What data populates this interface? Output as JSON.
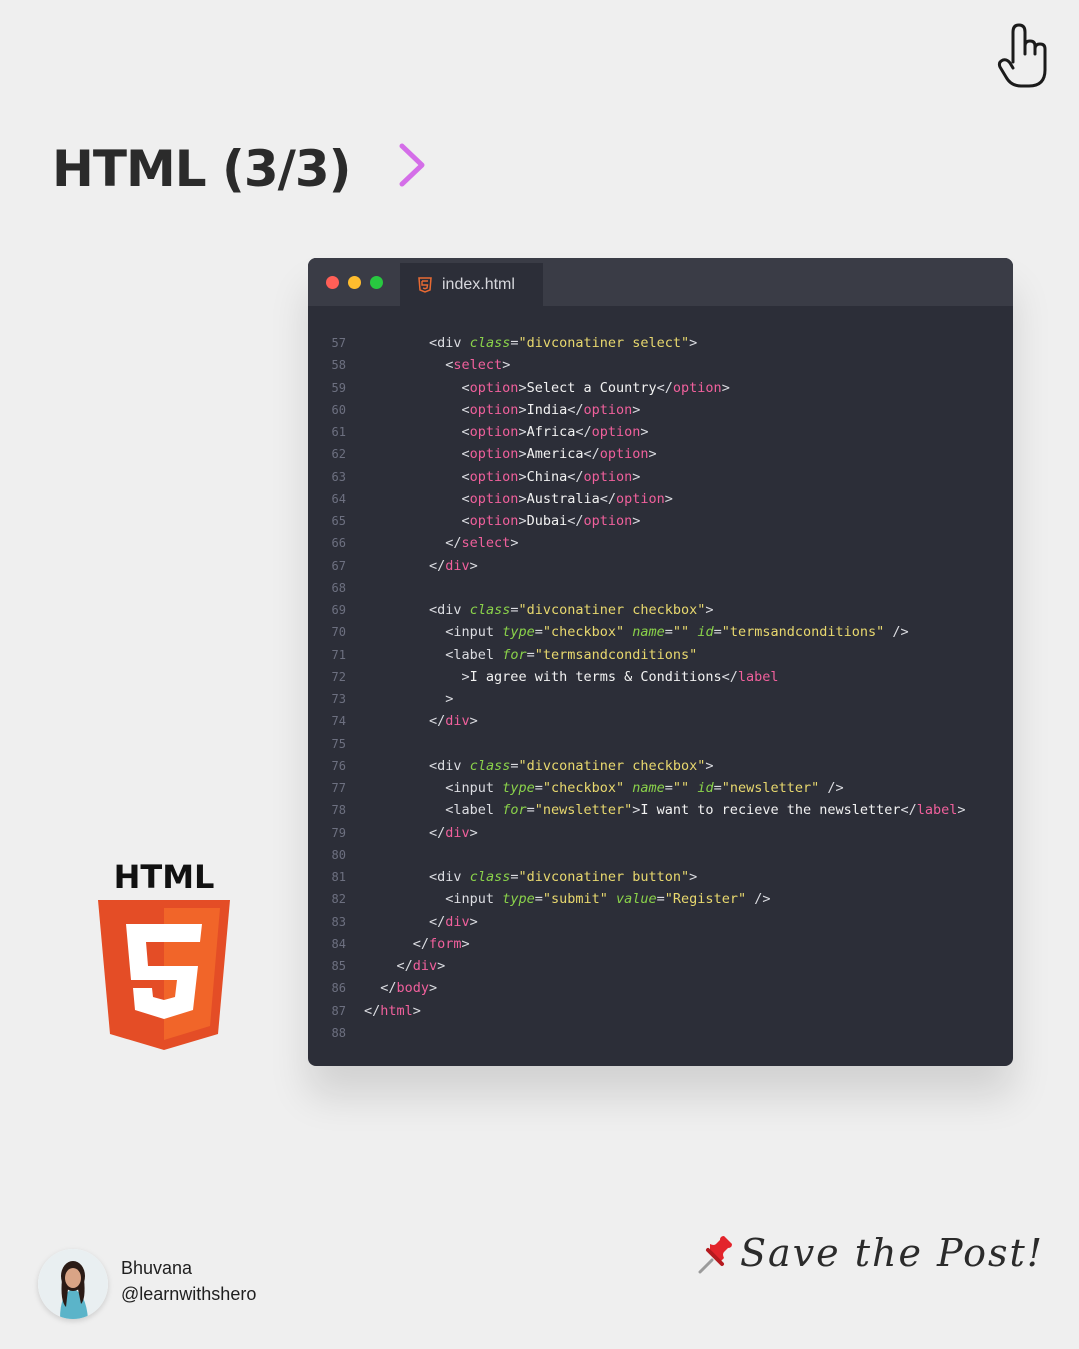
{
  "header": {
    "title": "HTML (3/3)",
    "icons": [
      "arrow-right-icon",
      "pointing-hand-icon"
    ],
    "arrow_gradient": [
      "#7fd0f5",
      "#d46ee8"
    ]
  },
  "editor": {
    "tab_label": "index.html",
    "tab_icon": "html5-icon",
    "window_dots": [
      "#ff5f57",
      "#ffbd2e",
      "#28c840"
    ],
    "colors": {
      "background": "#2c2e38",
      "tag": "#f0609c",
      "attr": "#8ad24a",
      "string": "#e8d86e"
    },
    "lines": [
      {
        "num": "57",
        "tokens": [
          [
            "        <",
            "p"
          ],
          [
            "div",
            "p"
          ],
          [
            " ",
            "p"
          ],
          [
            "class",
            "a"
          ],
          [
            "=",
            "p"
          ],
          [
            "\"divconatiner select\"",
            "s"
          ],
          [
            ">",
            "p"
          ]
        ]
      },
      {
        "num": "58",
        "tokens": [
          [
            "          <",
            "p"
          ],
          [
            "select",
            "t"
          ],
          [
            ">",
            "p"
          ]
        ]
      },
      {
        "num": "59",
        "tokens": [
          [
            "            <",
            "p"
          ],
          [
            "option",
            "t"
          ],
          [
            ">",
            "p"
          ],
          [
            "Select a Country",
            "x"
          ],
          [
            "</",
            "p"
          ],
          [
            "option",
            "t"
          ],
          [
            ">",
            "p"
          ]
        ]
      },
      {
        "num": "60",
        "tokens": [
          [
            "            <",
            "p"
          ],
          [
            "option",
            "t"
          ],
          [
            ">",
            "p"
          ],
          [
            "India",
            "x"
          ],
          [
            "</",
            "p"
          ],
          [
            "option",
            "t"
          ],
          [
            ">",
            "p"
          ]
        ]
      },
      {
        "num": "61",
        "tokens": [
          [
            "            <",
            "p"
          ],
          [
            "option",
            "t"
          ],
          [
            ">",
            "p"
          ],
          [
            "Africa",
            "x"
          ],
          [
            "</",
            "p"
          ],
          [
            "option",
            "t"
          ],
          [
            ">",
            "p"
          ]
        ]
      },
      {
        "num": "62",
        "tokens": [
          [
            "            <",
            "p"
          ],
          [
            "option",
            "t"
          ],
          [
            ">",
            "p"
          ],
          [
            "America",
            "x"
          ],
          [
            "</",
            "p"
          ],
          [
            "option",
            "t"
          ],
          [
            ">",
            "p"
          ]
        ]
      },
      {
        "num": "63",
        "tokens": [
          [
            "            <",
            "p"
          ],
          [
            "option",
            "t"
          ],
          [
            ">",
            "p"
          ],
          [
            "China",
            "x"
          ],
          [
            "</",
            "p"
          ],
          [
            "option",
            "t"
          ],
          [
            ">",
            "p"
          ]
        ]
      },
      {
        "num": "64",
        "tokens": [
          [
            "            <",
            "p"
          ],
          [
            "option",
            "t"
          ],
          [
            ">",
            "p"
          ],
          [
            "Australia",
            "x"
          ],
          [
            "</",
            "p"
          ],
          [
            "option",
            "t"
          ],
          [
            ">",
            "p"
          ]
        ]
      },
      {
        "num": "65",
        "tokens": [
          [
            "            <",
            "p"
          ],
          [
            "option",
            "t"
          ],
          [
            ">",
            "p"
          ],
          [
            "Dubai",
            "x"
          ],
          [
            "</",
            "p"
          ],
          [
            "option",
            "t"
          ],
          [
            ">",
            "p"
          ]
        ]
      },
      {
        "num": "66",
        "tokens": [
          [
            "          </",
            "p"
          ],
          [
            "select",
            "t"
          ],
          [
            ">",
            "p"
          ]
        ]
      },
      {
        "num": "67",
        "tokens": [
          [
            "        </",
            "p"
          ],
          [
            "div",
            "t"
          ],
          [
            ">",
            "p"
          ]
        ]
      },
      {
        "num": "68",
        "tokens": []
      },
      {
        "num": "69",
        "tokens": [
          [
            "        <",
            "p"
          ],
          [
            "div",
            "p"
          ],
          [
            " ",
            "p"
          ],
          [
            "class",
            "a"
          ],
          [
            "=",
            "p"
          ],
          [
            "\"divconatiner checkbox\"",
            "s"
          ],
          [
            ">",
            "p"
          ]
        ]
      },
      {
        "num": "70",
        "tokens": [
          [
            "          <",
            "p"
          ],
          [
            "input",
            "p"
          ],
          [
            " ",
            "p"
          ],
          [
            "type",
            "a"
          ],
          [
            "=",
            "p"
          ],
          [
            "\"checkbox\"",
            "s"
          ],
          [
            " ",
            "p"
          ],
          [
            "name",
            "a"
          ],
          [
            "=",
            "p"
          ],
          [
            "\"\"",
            "s"
          ],
          [
            " ",
            "p"
          ],
          [
            "id",
            "a"
          ],
          [
            "=",
            "p"
          ],
          [
            "\"termsandconditions\"",
            "s"
          ],
          [
            " />",
            "p"
          ]
        ]
      },
      {
        "num": "71",
        "tokens": [
          [
            "          <",
            "p"
          ],
          [
            "label",
            "p"
          ],
          [
            " ",
            "p"
          ],
          [
            "for",
            "a"
          ],
          [
            "=",
            "p"
          ],
          [
            "\"termsandconditions\"",
            "s"
          ]
        ]
      },
      {
        "num": "72",
        "tokens": [
          [
            "            >",
            "p"
          ],
          [
            "I agree with terms & Conditions",
            "x"
          ],
          [
            "</",
            "p"
          ],
          [
            "label",
            "t"
          ]
        ]
      },
      {
        "num": "73",
        "tokens": [
          [
            "          >",
            "p"
          ]
        ]
      },
      {
        "num": "74",
        "tokens": [
          [
            "        </",
            "p"
          ],
          [
            "div",
            "t"
          ],
          [
            ">",
            "p"
          ]
        ]
      },
      {
        "num": "75",
        "tokens": []
      },
      {
        "num": "76",
        "tokens": [
          [
            "        <",
            "p"
          ],
          [
            "div",
            "p"
          ],
          [
            " ",
            "p"
          ],
          [
            "class",
            "a"
          ],
          [
            "=",
            "p"
          ],
          [
            "\"divconatiner checkbox\"",
            "s"
          ],
          [
            ">",
            "p"
          ]
        ]
      },
      {
        "num": "77",
        "tokens": [
          [
            "          <",
            "p"
          ],
          [
            "input",
            "p"
          ],
          [
            " ",
            "p"
          ],
          [
            "type",
            "a"
          ],
          [
            "=",
            "p"
          ],
          [
            "\"checkbox\"",
            "s"
          ],
          [
            " ",
            "p"
          ],
          [
            "name",
            "a"
          ],
          [
            "=",
            "p"
          ],
          [
            "\"\"",
            "s"
          ],
          [
            " ",
            "p"
          ],
          [
            "id",
            "a"
          ],
          [
            "=",
            "p"
          ],
          [
            "\"newsletter\"",
            "s"
          ],
          [
            " />",
            "p"
          ]
        ]
      },
      {
        "num": "78",
        "tokens": [
          [
            "          <",
            "p"
          ],
          [
            "label",
            "p"
          ],
          [
            " ",
            "p"
          ],
          [
            "for",
            "a"
          ],
          [
            "=",
            "p"
          ],
          [
            "\"newsletter\"",
            "s"
          ],
          [
            ">",
            "p"
          ],
          [
            "I want to recieve the newsletter",
            "x"
          ],
          [
            "</",
            "p"
          ],
          [
            "label",
            "t"
          ],
          [
            ">",
            "p"
          ]
        ]
      },
      {
        "num": "79",
        "tokens": [
          [
            "        </",
            "p"
          ],
          [
            "div",
            "t"
          ],
          [
            ">",
            "p"
          ]
        ]
      },
      {
        "num": "80",
        "tokens": []
      },
      {
        "num": "81",
        "tokens": [
          [
            "        <",
            "p"
          ],
          [
            "div",
            "p"
          ],
          [
            " ",
            "p"
          ],
          [
            "class",
            "a"
          ],
          [
            "=",
            "p"
          ],
          [
            "\"divconatiner button\"",
            "s"
          ],
          [
            ">",
            "p"
          ]
        ]
      },
      {
        "num": "82",
        "tokens": [
          [
            "          <",
            "p"
          ],
          [
            "input",
            "p"
          ],
          [
            " ",
            "p"
          ],
          [
            "type",
            "a"
          ],
          [
            "=",
            "p"
          ],
          [
            "\"submit\"",
            "s"
          ],
          [
            " ",
            "p"
          ],
          [
            "value",
            "a"
          ],
          [
            "=",
            "p"
          ],
          [
            "\"Register\"",
            "s"
          ],
          [
            " />",
            "p"
          ]
        ]
      },
      {
        "num": "83",
        "tokens": [
          [
            "        </",
            "p"
          ],
          [
            "div",
            "t"
          ],
          [
            ">",
            "p"
          ]
        ]
      },
      {
        "num": "84",
        "tokens": [
          [
            "      </",
            "p"
          ],
          [
            "form",
            "t"
          ],
          [
            ">",
            "p"
          ]
        ]
      },
      {
        "num": "85",
        "tokens": [
          [
            "    </",
            "p"
          ],
          [
            "div",
            "t"
          ],
          [
            ">",
            "p"
          ]
        ]
      },
      {
        "num": "86",
        "tokens": [
          [
            "  </",
            "p"
          ],
          [
            "body",
            "t"
          ],
          [
            ">",
            "p"
          ]
        ]
      },
      {
        "num": "87",
        "tokens": [
          [
            "</",
            "p"
          ],
          [
            "html",
            "t"
          ],
          [
            ">",
            "p"
          ]
        ]
      },
      {
        "num": "88",
        "tokens": []
      }
    ]
  },
  "logo": {
    "label": "HTML",
    "badge": "5",
    "icon": "html5-shield-icon",
    "colors": {
      "outer": "#e44d26",
      "inner": "#f16529"
    }
  },
  "author": {
    "name": "Bhuvana",
    "handle": "@learnwithshero",
    "avatar_icon": "avatar"
  },
  "footer": {
    "save_text": "Save the Post!",
    "pin_icon": "pushpin-icon"
  }
}
